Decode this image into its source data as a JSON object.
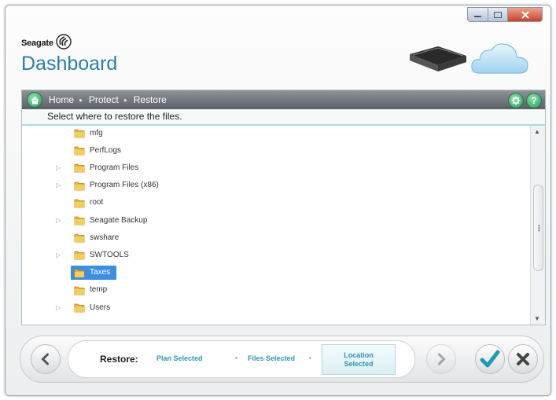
{
  "window": {
    "controls": {
      "minimize": "minimize-icon",
      "maximize": "maximize-icon",
      "close": "close-icon"
    }
  },
  "brand": {
    "company": "Seagate",
    "app": "Dashboard",
    "accent_color": "#2a7fa3"
  },
  "nav": {
    "breadcrumbs": [
      "Home",
      "Protect",
      "Restore"
    ],
    "icons": {
      "home": "home-icon",
      "settings": "gear-icon",
      "help": "help-icon"
    }
  },
  "instruction": "Select where to restore the files.",
  "tree": {
    "items": [
      {
        "label": "mfg",
        "expandable": false,
        "selected": false
      },
      {
        "label": "PerfLogs",
        "expandable": false,
        "selected": false
      },
      {
        "label": "Program Files",
        "expandable": true,
        "selected": false
      },
      {
        "label": "Program Files (x86)",
        "expandable": true,
        "selected": false
      },
      {
        "label": "root",
        "expandable": false,
        "selected": false
      },
      {
        "label": "Seagate Backup",
        "expandable": true,
        "selected": false
      },
      {
        "label": "swshare",
        "expandable": false,
        "selected": false
      },
      {
        "label": "SWTOOLS",
        "expandable": true,
        "selected": false
      },
      {
        "label": "Taxes",
        "expandable": false,
        "selected": true
      },
      {
        "label": "temp",
        "expandable": false,
        "selected": false
      },
      {
        "label": "Users",
        "expandable": true,
        "selected": false
      }
    ],
    "selection_color": "#3a8fe0"
  },
  "footer": {
    "label": "Restore:",
    "steps": [
      "Plan Selected",
      "Files Selected"
    ],
    "active_step": "Location Selected",
    "step_color": "#2c97b0",
    "buttons": {
      "back": "chevron-left-icon",
      "forward": "chevron-right-icon",
      "ok": "checkmark-icon",
      "cancel": "x-icon"
    }
  }
}
